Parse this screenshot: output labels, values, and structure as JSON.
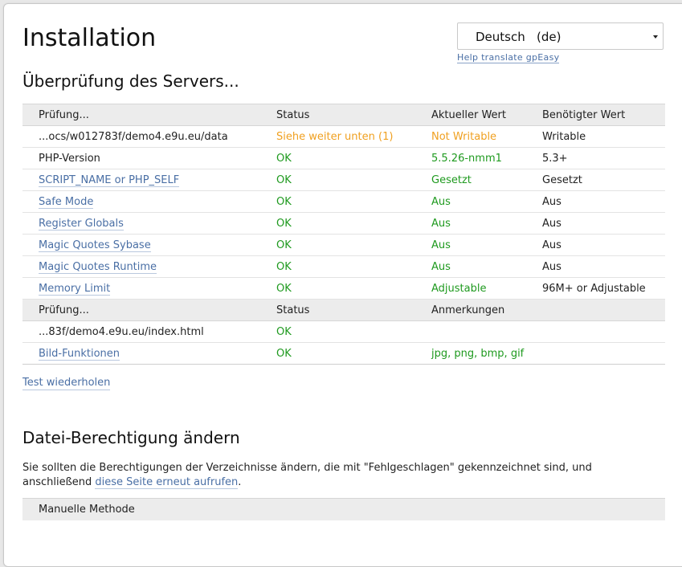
{
  "page": {
    "title": "Installation"
  },
  "language": {
    "selected": "Deutsch   (de)",
    "help_link": "Help translate gpEasy"
  },
  "server_check": {
    "title": "Überprüfung des Servers...",
    "headers1": [
      "Prüfung...",
      "Status",
      "Aktueller Wert",
      "Benötigter Wert"
    ],
    "rows1": [
      {
        "check": "...ocs/w012783f/demo4.e9u.eu/data",
        "status": "Siehe weiter unten (1)",
        "current": "Not Writable",
        "required": "Writable"
      },
      {
        "check": "PHP-Version",
        "status": "OK",
        "current": "5.5.26-nmm1",
        "required": "5.3+"
      },
      {
        "check": "SCRIPT_NAME or PHP_SELF",
        "status": "OK",
        "current": "Gesetzt",
        "required": "Gesetzt"
      },
      {
        "check": "Safe Mode",
        "status": "OK",
        "current": "Aus",
        "required": "Aus"
      },
      {
        "check": "Register Globals",
        "status": "OK",
        "current": "Aus",
        "required": "Aus"
      },
      {
        "check": "Magic Quotes Sybase",
        "status": "OK",
        "current": "Aus",
        "required": "Aus"
      },
      {
        "check": "Magic Quotes Runtime",
        "status": "OK",
        "current": "Aus",
        "required": "Aus"
      },
      {
        "check": "Memory Limit",
        "status": "OK",
        "current": "Adjustable",
        "required": "96M+ or Adjustable"
      }
    ],
    "headers2": [
      "Prüfung...",
      "Status",
      "Anmerkungen"
    ],
    "rows2": [
      {
        "check": "...83f/demo4.e9u.eu/index.html",
        "status": "OK",
        "notes": ""
      },
      {
        "check": "Bild-Funktionen",
        "status": "OK",
        "notes": "jpg, png, bmp, gif"
      }
    ],
    "retry_link": "Test wiederholen"
  },
  "permissions": {
    "title": "Datei-Berechtigung ändern",
    "text_before": "Sie sollten die Berechtigungen der Verzeichnisse ändern, die mit \"Fehlgeschlagen\" gekennzeichnet sind, und anschließend ",
    "reload_link": "diese Seite erneut aufrufen",
    "text_after": ".",
    "method_label": "Manuelle Methode"
  },
  "colors": {
    "ok": "#1f9a1f",
    "warning": "#f0a020",
    "link": "#4a6fa5"
  }
}
